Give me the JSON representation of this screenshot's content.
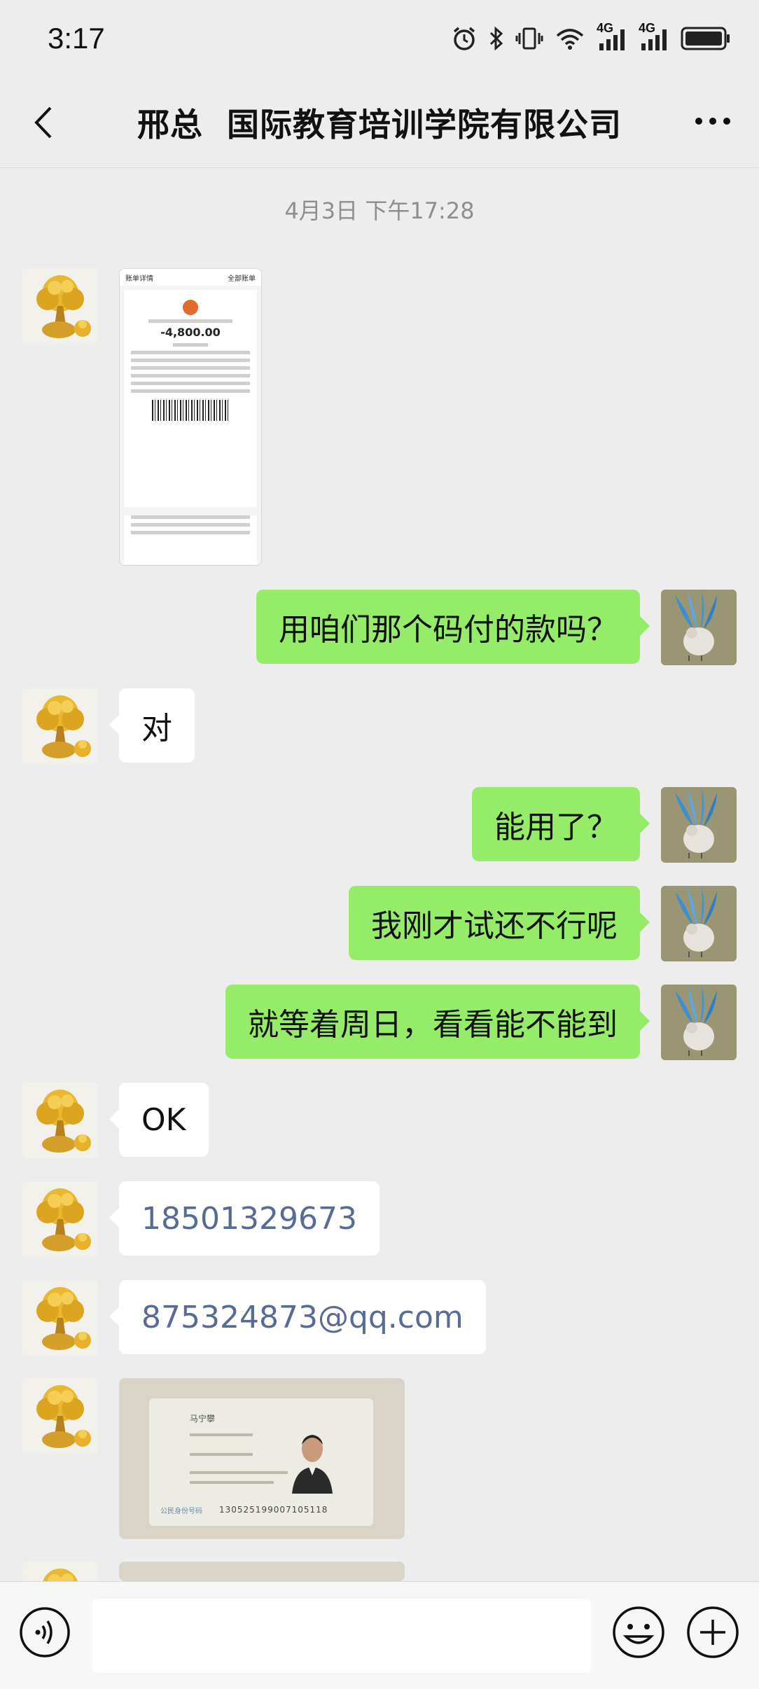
{
  "status_bar": {
    "time": "3:17",
    "network_labels": [
      "4G",
      "4G"
    ],
    "icons": [
      "alarm-icon",
      "bluetooth-icon",
      "vibrate-icon",
      "wifi-icon",
      "signal-icon",
      "signal-icon",
      "battery-icon"
    ]
  },
  "nav": {
    "title": "邢总  国际教育培训学院有限公司",
    "back_icon": "chevron-left-icon",
    "more_icon": "more-icon"
  },
  "timestamp": "4月3日 下午17:28",
  "receipt_thumb": {
    "header_left": "账单详情",
    "header_right": "全部账单",
    "amount": "-4,800.00"
  },
  "messages": {
    "m1": "用咱们那个码付的款吗？",
    "m2": "对",
    "m3": "能用了？",
    "m4": "我刚才试还不行呢",
    "m5": "就等着周日，看看能不能到",
    "m6": "OK",
    "m7": "18501329673",
    "m8": "875324873@qq.com"
  },
  "id_card": {
    "name": "马宁攀",
    "id_label": "公民身份号码",
    "id_number": "130525199007105118"
  },
  "input_bar": {
    "placeholder": "",
    "icons": [
      "voice-icon",
      "emoji-icon",
      "plus-icon"
    ]
  },
  "colors": {
    "background": "#ededed",
    "bubble_self": "#95ec69",
    "bubble_other": "#ffffff",
    "link": "#576b95"
  }
}
